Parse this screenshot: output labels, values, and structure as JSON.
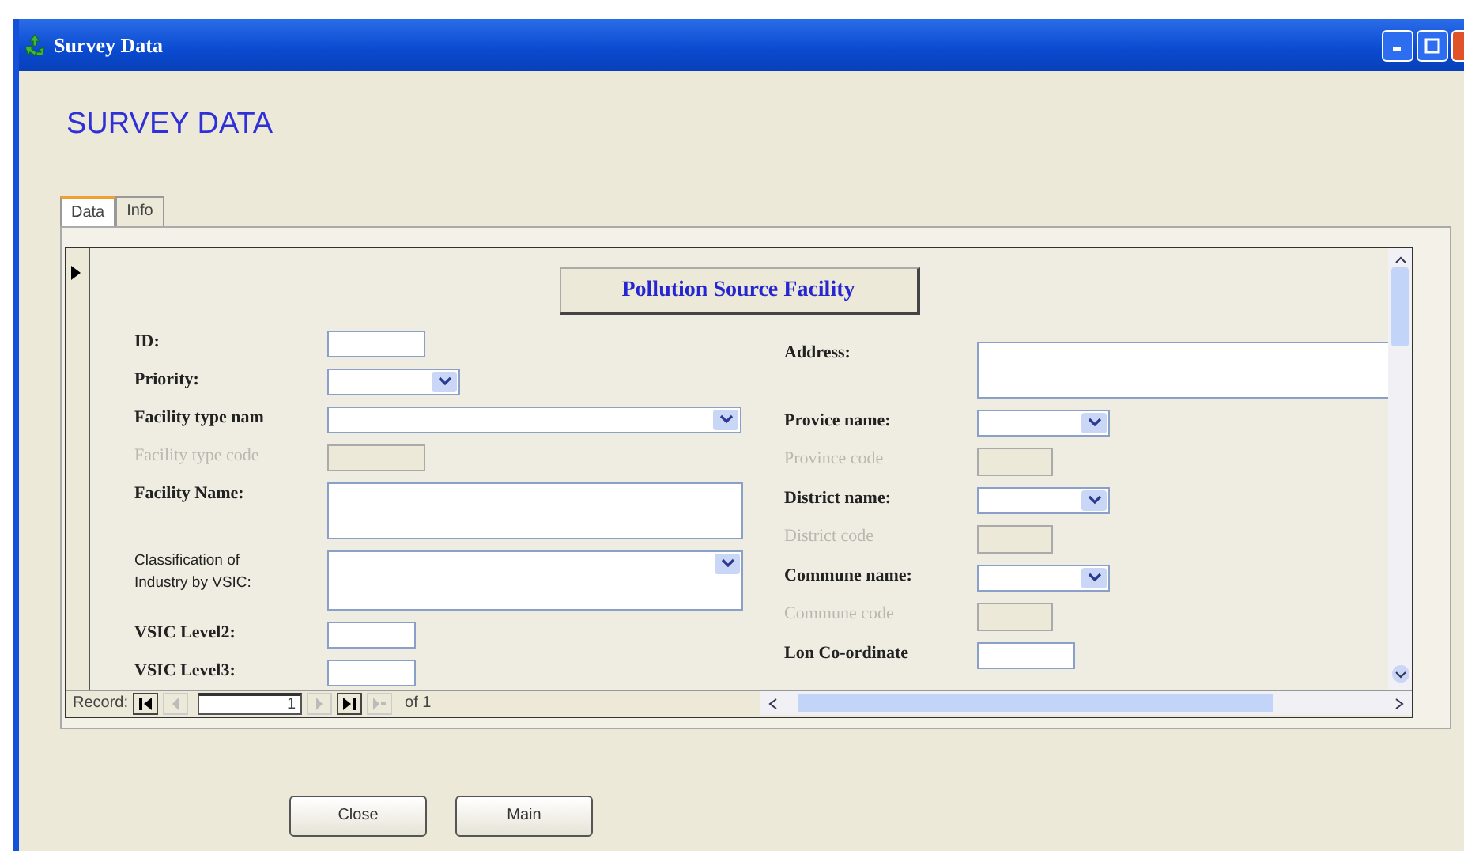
{
  "window": {
    "title": "Survey Data"
  },
  "header": "SURVEY DATA",
  "tabs": [
    {
      "label": "Data",
      "selected": true
    },
    {
      "label": "Info",
      "selected": false
    }
  ],
  "form": {
    "heading": "Pollution Source Facility",
    "left_fields": [
      {
        "label": "ID:",
        "kind": "text",
        "disabled": false
      },
      {
        "label": "Priority:",
        "kind": "combo",
        "disabled": false
      },
      {
        "label": "Facility type nam",
        "kind": "combo-wide",
        "disabled": false
      },
      {
        "label": "Facility type code",
        "kind": "text",
        "disabled": true
      },
      {
        "label": "Facility Name:",
        "kind": "memo",
        "disabled": false
      },
      {
        "label": "Classification of Industry by VSIC:",
        "kind": "memo-list",
        "disabled": false
      },
      {
        "label": "VSIC  Level2:",
        "kind": "short",
        "disabled": false
      },
      {
        "label": "VSIC  Level3:",
        "kind": "short",
        "disabled": false
      }
    ],
    "right_fields": [
      {
        "label": "Address:",
        "kind": "memo",
        "disabled": false
      },
      {
        "label": "Provice name:",
        "kind": "combo",
        "disabled": false
      },
      {
        "label": "Province code",
        "kind": "code",
        "disabled": true
      },
      {
        "label": "District name:",
        "kind": "combo",
        "disabled": false
      },
      {
        "label": "District code",
        "kind": "code",
        "disabled": true
      },
      {
        "label": "Commune name:",
        "kind": "combo",
        "disabled": false
      },
      {
        "label": "Commune code",
        "kind": "code",
        "disabled": true
      },
      {
        "label": "Lon Co-ordinate",
        "kind": "text",
        "disabled": false
      }
    ]
  },
  "record_nav": {
    "label": "Record:",
    "current": "1",
    "total": "of 1"
  },
  "buttons": [
    "Close",
    "Main"
  ]
}
